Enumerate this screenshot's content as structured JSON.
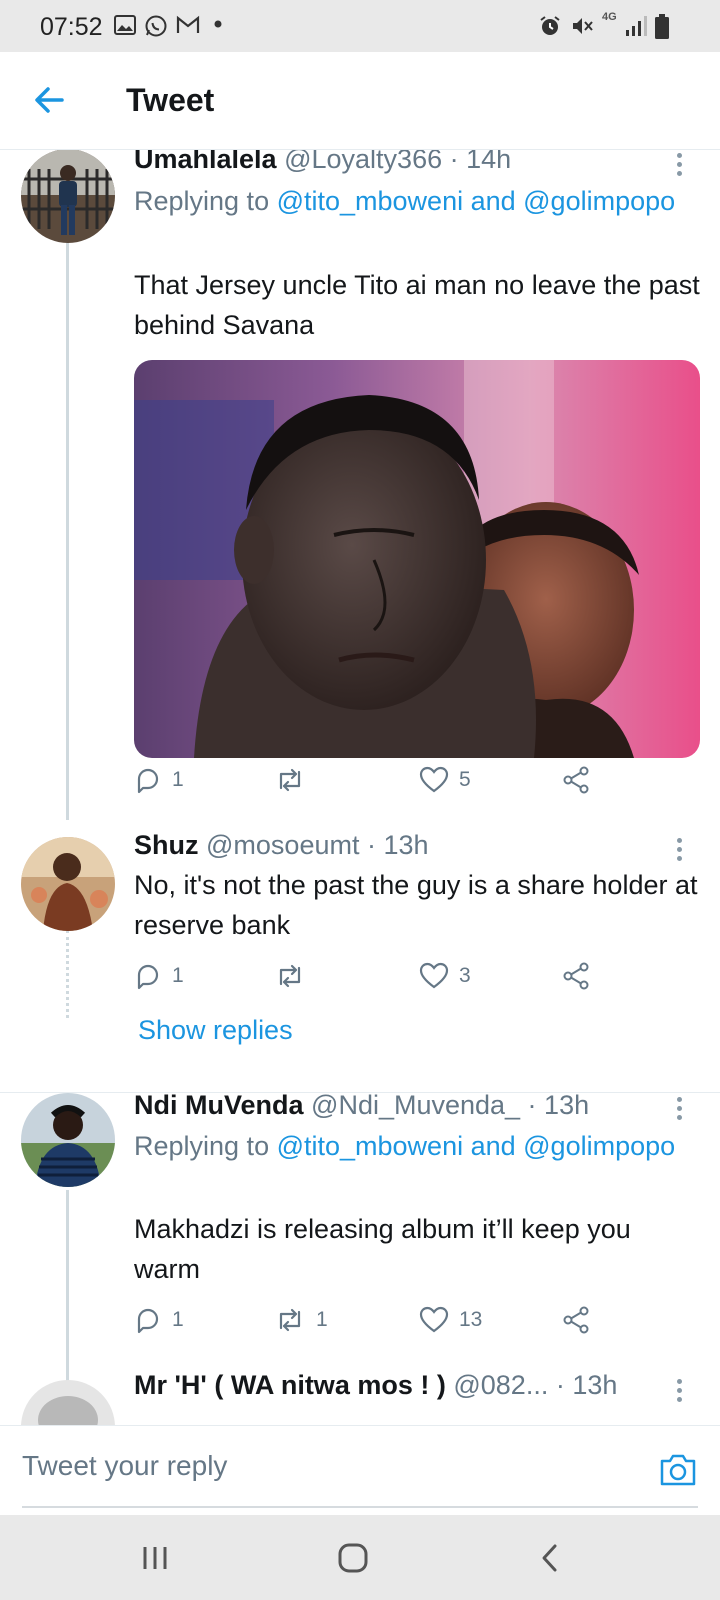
{
  "status_bar": {
    "time": "07:52",
    "network": "4G",
    "icons": [
      "gallery-icon",
      "whatsapp-icon",
      "gmail-icon",
      "dot-icon",
      "alarm-icon",
      "mute-icon",
      "signal-icon",
      "battery-icon"
    ]
  },
  "header": {
    "title": "Tweet",
    "back_icon": "back-arrow-icon"
  },
  "tweets": [
    {
      "name": "Umahlalela",
      "handle": "@Loyalty366 · 14h",
      "replying_prefix": "Replying to ",
      "replying_to": "@tito_mboweni and @golimpopo",
      "text": "That Jersey uncle Tito ai man no leave the past behind Savana",
      "has_media": true,
      "replies": "1",
      "retweets": "",
      "likes": "5"
    },
    {
      "name": "Shuz",
      "handle": "@mosoeumt · 13h",
      "text": "No, it's not the past the guy is a share holder at reserve bank",
      "replies": "1",
      "retweets": "",
      "likes": "3",
      "show_replies": "Show replies"
    },
    {
      "name": "Ndi MuVenda",
      "handle": "@Ndi_Muvenda_ · 13h",
      "replying_prefix": "Replying to ",
      "replying_to": "@tito_mboweni and @golimpopo",
      "text": "Makhadzi is releasing album it’ll keep you warm",
      "replies": "1",
      "retweets": "1",
      "likes": "13"
    },
    {
      "name": "Mr 'H' ( WA nitwa mos ! )",
      "handle": "@082... · 13h"
    }
  ],
  "reply_bar": {
    "placeholder": "Tweet your reply"
  },
  "colors": {
    "accent": "#1b95e0",
    "muted": "#657786",
    "text": "#14171a"
  }
}
